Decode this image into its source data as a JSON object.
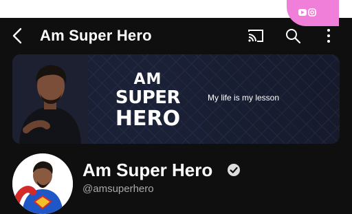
{
  "header": {
    "title": "Am Super Hero"
  },
  "banner": {
    "logo_line1": "AM",
    "logo_line2": "SUPER",
    "logo_line3": "HERO",
    "tagline": "My life is my lesson",
    "accent_color": "#ef7fd8"
  },
  "channel": {
    "name": "Am Super Hero",
    "handle": "@amsuperhero"
  },
  "icons": {
    "back": "back-arrow-icon",
    "cast": "cast-icon",
    "search": "search-icon",
    "more": "more-vertical-icon",
    "verified": "verified-check-icon"
  }
}
